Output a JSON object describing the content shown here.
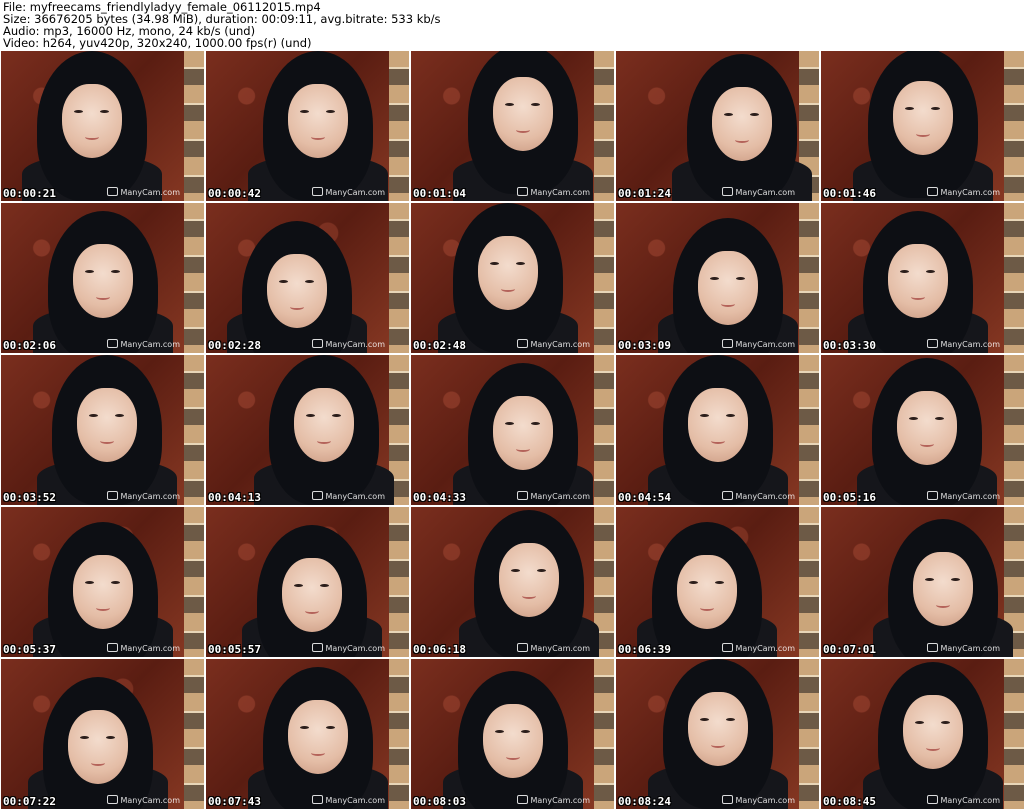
{
  "header": {
    "file_line": "File: myfreecams_friendlyladyy_female_06112015.mp4",
    "size_line": "Size: 36676205 bytes (34.98 MiB), duration: 00:09:11, avg.bitrate: 533 kb/s",
    "audio_line": "Audio: mp3, 16000 Hz, mono, 24 kb/s (und)",
    "video_line": "Video: h264, yuv420p, 320x240, 1000.00 fps(r) (und)"
  },
  "watermark": "ManyCam.com",
  "thumbnails": [
    {
      "time": "00:00:21"
    },
    {
      "time": "00:00:42"
    },
    {
      "time": "00:01:04"
    },
    {
      "time": "00:01:24"
    },
    {
      "time": "00:01:46"
    },
    {
      "time": "00:02:06"
    },
    {
      "time": "00:02:28"
    },
    {
      "time": "00:02:48"
    },
    {
      "time": "00:03:09"
    },
    {
      "time": "00:03:30"
    },
    {
      "time": "00:03:52"
    },
    {
      "time": "00:04:13"
    },
    {
      "time": "00:04:33"
    },
    {
      "time": "00:04:54"
    },
    {
      "time": "00:05:16"
    },
    {
      "time": "00:05:37"
    },
    {
      "time": "00:05:57"
    },
    {
      "time": "00:06:18"
    },
    {
      "time": "00:06:39"
    },
    {
      "time": "00:07:01"
    },
    {
      "time": "00:07:22"
    },
    {
      "time": "00:07:43"
    },
    {
      "time": "00:08:03"
    },
    {
      "time": "00:08:24"
    },
    {
      "time": "00:08:45"
    }
  ]
}
